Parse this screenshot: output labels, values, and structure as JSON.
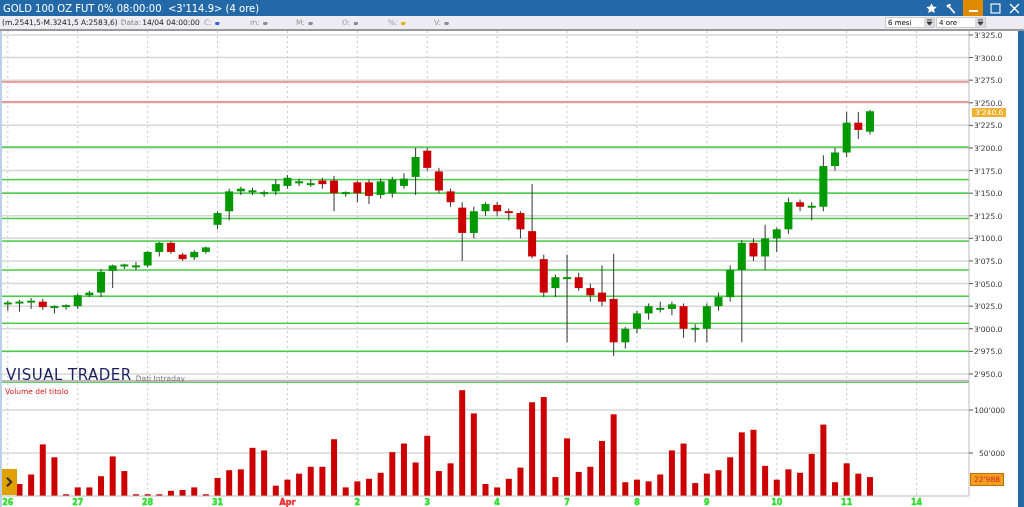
{
  "window": {
    "title": "GOLD 100 OZ FUT 0% 08:00:00  <3'114.9> (4 ore)"
  },
  "toolbar": {
    "range": "(m.2541,5-M.3241,5 A:2583,6)",
    "date_label": "Data:",
    "date_value": "14/04 04:00:00",
    "fields": [
      {
        "label": "C:",
        "value": "-",
        "color": "#3b5bdb"
      },
      {
        "label": "m:",
        "value": "-",
        "color": "#8a8a8a"
      },
      {
        "label": "M:",
        "value": "-",
        "color": "#8a8a8a"
      },
      {
        "label": "O:",
        "value": "-",
        "color": "#8a8a8a"
      },
      {
        "label": "%:",
        "value": "-",
        "color": "#e0b000"
      },
      {
        "label": "V:",
        "value": "-",
        "color": "#8a8a8a"
      }
    ],
    "period": "6 mesi",
    "interval": "4 ore"
  },
  "price_pane": {
    "logo": "VISUAL TRADER",
    "subtitle": "Dati Intraday",
    "last_price_badge": "3'240.6",
    "chart_data": {
      "type": "candlestick",
      "ylim": [
        2940,
        3329.4
      ],
      "grid": true,
      "categories": [
        null,
        null,
        null,
        null,
        null,
        null,
        null,
        null,
        null,
        null,
        null,
        null,
        null,
        null,
        null,
        null,
        null,
        null,
        null,
        null,
        null,
        null,
        null,
        null,
        null,
        null,
        null,
        null,
        null,
        null,
        null,
        null,
        null,
        null,
        null,
        null,
        null,
        null,
        null,
        null,
        null,
        null,
        null,
        null,
        null,
        null,
        null,
        null,
        null,
        null,
        null,
        null,
        null,
        null,
        null,
        null,
        null,
        null,
        null,
        null,
        null,
        null,
        null,
        null,
        null,
        null,
        null,
        null,
        null,
        null,
        null,
        null,
        null,
        null,
        null,
        null,
        null,
        null,
        null,
        null,
        null,
        null,
        null
      ],
      "yticks": [
        {
          "value": 3325,
          "label": "3'325.0"
        },
        {
          "value": 3300,
          "label": "3'300.0"
        },
        {
          "value": 3275,
          "label": "3'275.0"
        },
        {
          "value": 3250,
          "label": "3'250.0"
        },
        {
          "value": 3225,
          "label": "3'225.0"
        },
        {
          "value": 3200,
          "label": "3'200.0"
        },
        {
          "value": 3175,
          "label": "3'175.0"
        },
        {
          "value": 3150,
          "label": "3'150.0"
        },
        {
          "value": 3125,
          "label": "3'125.0"
        },
        {
          "value": 3100,
          "label": "3'100.0"
        },
        {
          "value": 3075,
          "label": "3'075.0"
        },
        {
          "value": 3050,
          "label": "3'050.0"
        },
        {
          "value": 3025,
          "label": "3'025.0"
        },
        {
          "value": 3000,
          "label": "3'000.0"
        },
        {
          "value": 2975,
          "label": "2'975.0"
        },
        {
          "value": 2950,
          "label": "2'950.0"
        }
      ],
      "ref_lines": [
        {
          "axis": "y",
          "value": 3273,
          "color": "#f08080"
        },
        {
          "axis": "y",
          "value": 3251,
          "color": "#f08080"
        },
        {
          "axis": "y",
          "value": 3201,
          "color": "#44cc44"
        },
        {
          "axis": "y",
          "value": 3165,
          "color": "#44cc44"
        },
        {
          "axis": "y",
          "value": 3150,
          "color": "#44cc44"
        },
        {
          "axis": "y",
          "value": 3122,
          "color": "#44cc44"
        },
        {
          "axis": "y",
          "value": 3097,
          "color": "#44cc44"
        },
        {
          "axis": "y",
          "value": 3065,
          "color": "#44cc44"
        },
        {
          "axis": "y",
          "value": 3036,
          "color": "#44cc44"
        },
        {
          "axis": "y",
          "value": 3006,
          "color": "#44cc44"
        },
        {
          "axis": "y",
          "value": 2975,
          "color": "#44cc44"
        },
        {
          "axis": "y",
          "value": 2941,
          "color": "#44cc44"
        }
      ],
      "series": [
        {
          "ohlc": [
            [
              3027,
              3031,
              3020,
              3029
            ],
            [
              3029,
              3032,
              3019,
              3029
            ],
            [
              3030,
              3034,
              3022,
              3030
            ],
            [
              3030,
              3033,
              3021,
              3024
            ],
            [
              3024,
              3026,
              3017,
              3024
            ],
            [
              3025,
              3027,
              3021,
              3025
            ],
            [
              3025,
              3039,
              3022,
              3037
            ],
            [
              3037,
              3042,
              3035,
              3040
            ],
            [
              3040,
              3066,
              3035,
              3063
            ],
            [
              3064,
              3071,
              3045,
              3070
            ],
            [
              3070,
              3072,
              3066,
              3070
            ],
            [
              3069,
              3074,
              3065,
              3069
            ],
            [
              3070,
              3086,
              3068,
              3085
            ],
            [
              3085,
              3096,
              3080,
              3095
            ],
            [
              3095,
              3097,
              3083,
              3085
            ],
            [
              3082,
              3084,
              3075,
              3077
            ],
            [
              3079,
              3087,
              3076,
              3085
            ],
            [
              3085,
              3091,
              3083,
              3090
            ],
            [
              3115,
              3130,
              3110,
              3128
            ],
            [
              3130,
              3155,
              3120,
              3152
            ],
            [
              3152,
              3157,
              3148,
              3155
            ],
            [
              3152,
              3156,
              3148,
              3152
            ],
            [
              3150,
              3153,
              3146,
              3150
            ],
            [
              3152,
              3165,
              3148,
              3160
            ],
            [
              3158,
              3170,
              3155,
              3167
            ],
            [
              3162,
              3166,
              3158,
              3162
            ],
            [
              3160,
              3165,
              3157,
              3160
            ],
            [
              3164,
              3167,
              3155,
              3160
            ],
            [
              3164,
              3169,
              3130,
              3150
            ],
            [
              3150,
              3152,
              3146,
              3150
            ],
            [
              3162,
              3164,
              3140,
              3150
            ],
            [
              3162,
              3165,
              3138,
              3147
            ],
            [
              3148,
              3166,
              3144,
              3163
            ],
            [
              3150,
              3168,
              3145,
              3165
            ],
            [
              3158,
              3172,
              3155,
              3166
            ],
            [
              3168,
              3200,
              3148,
              3190
            ],
            [
              3197,
              3200,
              3175,
              3178
            ],
            [
              3174,
              3178,
              3150,
              3153
            ],
            [
              3152,
              3155,
              3135,
              3140
            ],
            [
              3134,
              3140,
              3075,
              3106
            ],
            [
              3106,
              3135,
              3100,
              3130
            ],
            [
              3130,
              3140,
              3125,
              3138
            ],
            [
              3137,
              3140,
              3125,
              3130
            ],
            [
              3130,
              3133,
              3120,
              3128
            ],
            [
              3128,
              3130,
              3100,
              3110
            ],
            [
              3108,
              3160,
              3078,
              3080
            ],
            [
              3077,
              3082,
              3035,
              3040
            ],
            [
              3045,
              3060,
              3035,
              3057
            ],
            [
              3055,
              3082,
              2985,
              3057
            ],
            [
              3057,
              3062,
              3042,
              3045
            ],
            [
              3045,
              3050,
              3030,
              3037
            ],
            [
              3040,
              3070,
              3025,
              3030
            ],
            [
              3033,
              3083,
              2970,
              2985
            ],
            [
              2985,
              3002,
              2978,
              3000
            ],
            [
              3000,
              3020,
              2995,
              3017
            ],
            [
              3017,
              3028,
              3010,
              3025
            ],
            [
              3022,
              3030,
              3018,
              3022
            ],
            [
              3022,
              3030,
              3015,
              3027
            ],
            [
              3025,
              3028,
              2990,
              3000
            ],
            [
              3000,
              3005,
              2985,
              3000
            ],
            [
              3000,
              3028,
              2985,
              3025
            ],
            [
              3025,
              3040,
              3020,
              3035
            ],
            [
              3035,
              3070,
              3030,
              3065
            ],
            [
              3065,
              3098,
              2985,
              3095
            ],
            [
              3095,
              3100,
              3075,
              3080
            ],
            [
              3080,
              3115,
              3065,
              3100
            ],
            [
              3100,
              3112,
              3085,
              3110
            ],
            [
              3110,
              3145,
              3105,
              3140
            ],
            [
              3140,
              3143,
              3130,
              3135
            ],
            [
              3135,
              3140,
              3120,
              3135
            ],
            [
              3135,
              3192,
              3130,
              3180
            ],
            [
              3180,
              3200,
              3175,
              3195
            ],
            [
              3195,
              3240,
              3190,
              3228
            ],
            [
              3228,
              3240,
              3210,
              3220
            ],
            [
              3218,
              3242,
              3215,
              3240.6
            ],
            null,
            null,
            null,
            null,
            null,
            null,
            null,
            null
          ]
        }
      ]
    }
  },
  "volume_pane": {
    "last_volume_badge": "22'988",
    "axis_labels": [
      {
        "color": "#33dd33"
      },
      {
        "color": "#33dd33"
      },
      {
        "color": "#33dd33"
      },
      {
        "color": "#33dd33"
      },
      {
        "color": "#ee3333"
      },
      {
        "color": "#33dd33"
      },
      {
        "color": "#33dd33"
      },
      {
        "color": "#33dd33"
      },
      {
        "color": "#33dd33"
      },
      {
        "color": "#33dd33"
      },
      {
        "color": "#33dd33"
      },
      {
        "color": "#33dd33"
      },
      {
        "color": "#33dd33"
      },
      {
        "color": "#33dd33"
      }
    ],
    "chart_data": {
      "type": "bar",
      "title": "Volume del titolo",
      "ylim": [
        0,
        131400
      ],
      "grid": true,
      "categories": [
        "26",
        null,
        null,
        null,
        null,
        null,
        "27",
        null,
        null,
        null,
        null,
        null,
        "28",
        null,
        null,
        null,
        null,
        null,
        "31",
        null,
        null,
        null,
        null,
        null,
        "Apr",
        null,
        null,
        null,
        null,
        null,
        "2",
        null,
        null,
        null,
        null,
        null,
        "3",
        null,
        null,
        null,
        null,
        null,
        "4",
        null,
        null,
        null,
        null,
        null,
        "7",
        null,
        null,
        null,
        null,
        null,
        "8",
        null,
        null,
        null,
        null,
        null,
        "9",
        null,
        null,
        null,
        null,
        null,
        "10",
        null,
        null,
        null,
        null,
        null,
        "11",
        null,
        null,
        null,
        null,
        null,
        "14",
        null,
        null,
        null,
        null
      ],
      "yticks": [
        {
          "value": 100000,
          "label": "100'000"
        },
        {
          "value": 50000,
          "label": "50'000"
        }
      ],
      "series": [
        {
          "color": "#cc0000",
          "values": [
            null,
            14000,
            25000,
            60000,
            45000,
            2000,
            10000,
            10000,
            23000,
            46000,
            29000,
            2000,
            2000,
            2000,
            6000,
            7000,
            10000,
            2000,
            21000,
            30000,
            31000,
            56000,
            53000,
            12000,
            19000,
            26000,
            34000,
            34000,
            66000,
            10000,
            17000,
            20000,
            27000,
            51000,
            61000,
            39000,
            70000,
            29000,
            38000,
            123000,
            96000,
            14000,
            10000,
            20000,
            33000,
            109000,
            115000,
            22000,
            67000,
            28000,
            34000,
            64000,
            95000,
            16000,
            19000,
            17000,
            25000,
            53000,
            61000,
            15000,
            26000,
            30000,
            45000,
            74000,
            77000,
            35000,
            19000,
            31000,
            27000,
            49000,
            83000,
            16000,
            38000,
            26000,
            22000,
            null,
            null,
            null,
            null,
            null,
            null,
            null,
            null
          ]
        }
      ]
    }
  }
}
